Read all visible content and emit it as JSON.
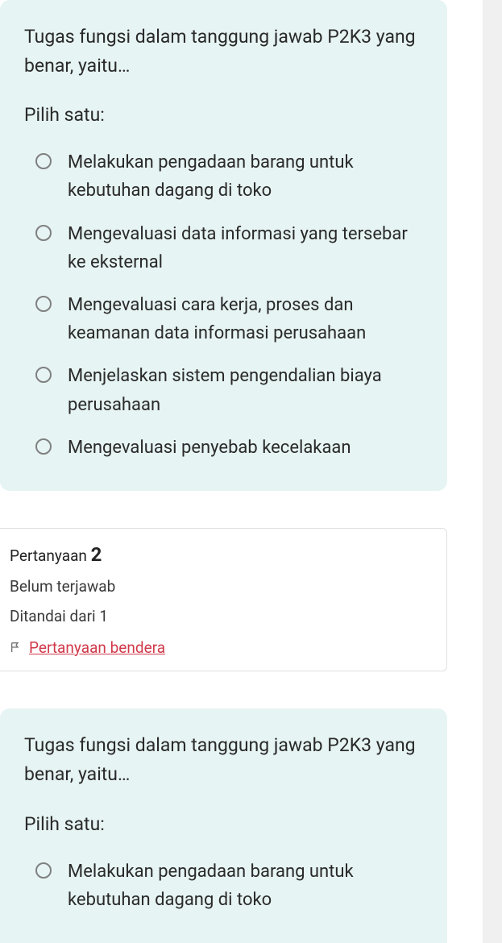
{
  "q1": {
    "text": "Tugas fungsi dalam tanggung jawab P2K3 yang benar, yaitu…",
    "choose": "Pilih satu:",
    "options": [
      "Melakukan pengadaan barang untuk kebutuhan dagang di toko",
      "Mengevaluasi data informasi yang tersebar ke eksternal",
      "Mengevaluasi cara kerja, proses dan keamanan data informasi perusahaan",
      "Menjelaskan sistem pengendalian biaya perusahaan",
      "Mengevaluasi penyebab kecelakaan"
    ]
  },
  "info": {
    "label": "Pertanyaan",
    "number": "2",
    "status": "Belum terjawab",
    "marked": "Ditandai dari 1",
    "flag": "Pertanyaan bendera"
  },
  "q2": {
    "text": "Tugas fungsi dalam tanggung jawab P2K3 yang benar, yaitu…",
    "choose": "Pilih satu:",
    "options": [
      "Melakukan pengadaan barang untuk kebutuhan dagang di toko"
    ]
  }
}
